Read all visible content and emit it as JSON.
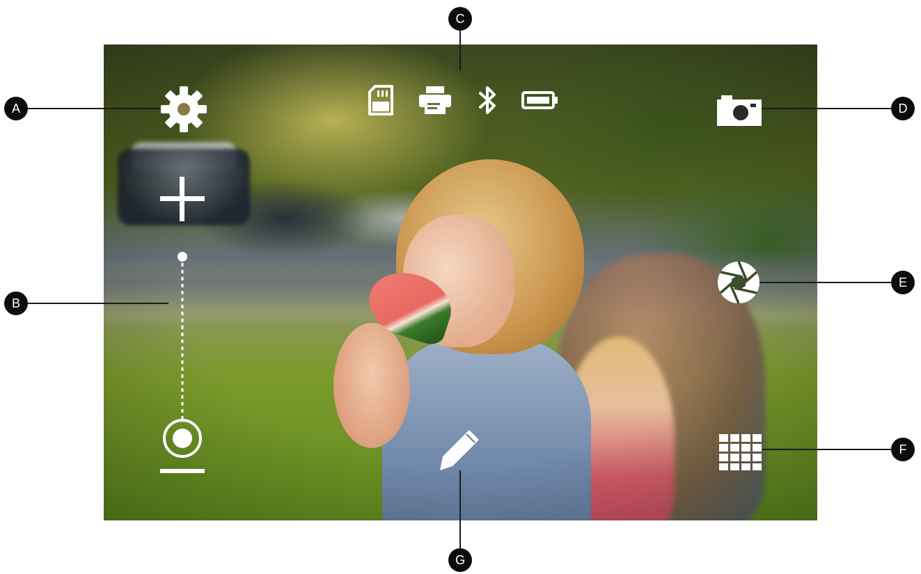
{
  "callouts": {
    "a": "A",
    "b": "B",
    "c": "C",
    "d": "D",
    "e": "E",
    "f": "F",
    "g": "G"
  },
  "icons": {
    "settings": "gear-icon",
    "zoom_in": "plus-icon",
    "zoom_slider": "zoom-slider",
    "zoom_out": "zoom-out-icon",
    "sd_card": "sd-card-icon",
    "printer": "printer-icon",
    "bluetooth": "bluetooth-icon",
    "battery": "battery-icon",
    "camera": "camera-icon",
    "shutter": "aperture-icon",
    "gallery": "grid-icon",
    "edit": "pencil-icon"
  },
  "colors": {
    "icon": "#ffffff",
    "callout_badge": "#0c0c0c",
    "callout_line": "#1a1a1a"
  }
}
